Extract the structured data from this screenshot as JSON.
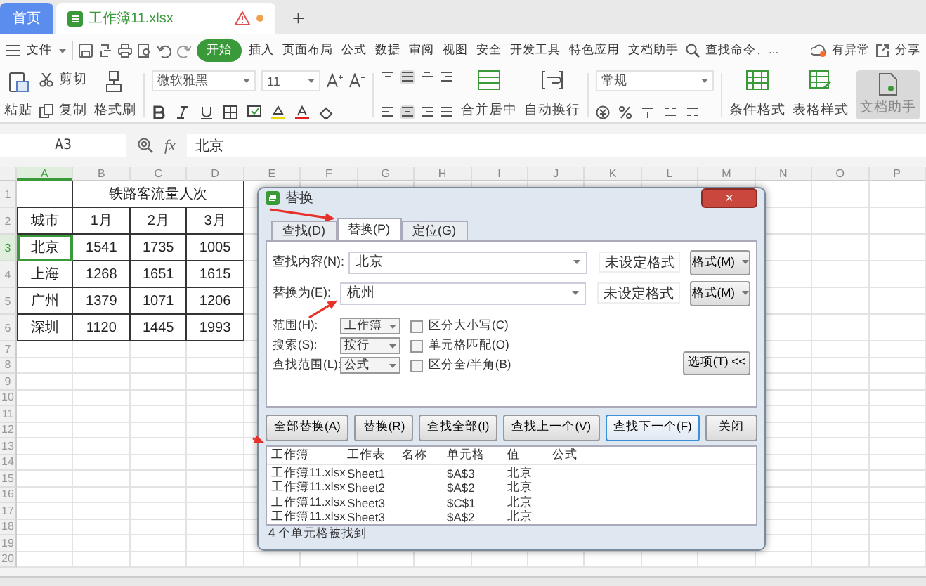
{
  "app_tabs": [
    {
      "label": "首页",
      "kind": "home",
      "selected": false
    },
    {
      "label": "工作簿11.xlsx",
      "kind": "document",
      "selected": true,
      "warning": true,
      "unsaved": true
    }
  ],
  "new_tab": "+",
  "menu": {
    "file": "文件",
    "tabs": [
      {
        "label": "开始",
        "selected": true
      },
      {
        "label": "插入",
        "selected": false
      },
      {
        "label": "页面布局",
        "selected": false
      },
      {
        "label": "公式",
        "selected": false
      },
      {
        "label": "数据",
        "selected": false
      },
      {
        "label": "审阅",
        "selected": false
      },
      {
        "label": "视图",
        "selected": false
      },
      {
        "label": "安全",
        "selected": false
      },
      {
        "label": "开发工具",
        "selected": false
      },
      {
        "label": "特色应用",
        "selected": false
      },
      {
        "label": "文档助手",
        "selected": false
      }
    ],
    "search": "查找命令、...",
    "alert": "有异常",
    "share": "分享"
  },
  "ribbon": {
    "paste": "粘贴",
    "cut": "剪切",
    "copy": "复制",
    "format_painter": "格式刷",
    "font": "微软雅黑",
    "font_size": "11",
    "merge": "合并居中",
    "wrap": "自动换行",
    "number_format": "常规",
    "conditional_format": "条件格式",
    "table_style": "表格样式",
    "assistant": "文档助手"
  },
  "formula_bar": {
    "cell": "A3",
    "fx": "fx",
    "value": "北京"
  },
  "sheet": {
    "columns": [
      {
        "label": "A",
        "selected": true
      },
      {
        "label": "B",
        "selected": false
      },
      {
        "label": "C",
        "selected": false
      },
      {
        "label": "D",
        "selected": false
      },
      {
        "label": "E",
        "selected": false
      },
      {
        "label": "F",
        "selected": false
      },
      {
        "label": "G",
        "selected": false
      },
      {
        "label": "H",
        "selected": false
      },
      {
        "label": "I",
        "selected": false
      },
      {
        "label": "J",
        "selected": false
      },
      {
        "label": "K",
        "selected": false
      },
      {
        "label": "L",
        "selected": false
      },
      {
        "label": "M",
        "selected": false
      },
      {
        "label": "N",
        "selected": false
      },
      {
        "label": "O",
        "selected": false
      },
      {
        "label": "P",
        "selected": false
      }
    ],
    "rows": [
      {
        "number": "1",
        "selected": false,
        "cells": [
          "",
          "铁路客流量人次"
        ],
        "merged_title": true
      },
      {
        "number": "2",
        "selected": false,
        "cells": [
          "城市",
          "1月",
          "2月",
          "3月"
        ]
      },
      {
        "number": "3",
        "selected": true,
        "cells": [
          "北京",
          "1541",
          "1735",
          "1005"
        ]
      },
      {
        "number": "4",
        "selected": false,
        "cells": [
          "上海",
          "1268",
          "1651",
          "1615"
        ]
      },
      {
        "number": "5",
        "selected": false,
        "cells": [
          "广州",
          "1379",
          "1071",
          "1206"
        ]
      },
      {
        "number": "6",
        "selected": false,
        "cells": [
          "深圳",
          "1120",
          "1445",
          "1993"
        ]
      },
      {
        "number": "7",
        "selected": false,
        "cells": []
      },
      {
        "number": "8",
        "selected": false,
        "cells": []
      },
      {
        "number": "9",
        "selected": false,
        "cells": []
      },
      {
        "number": "10",
        "selected": false,
        "cells": []
      },
      {
        "number": "11",
        "selected": false,
        "cells": []
      },
      {
        "number": "12",
        "selected": false,
        "cells": []
      },
      {
        "number": "13",
        "selected": false,
        "cells": []
      },
      {
        "number": "14",
        "selected": false,
        "cells": []
      },
      {
        "number": "15",
        "selected": false,
        "cells": []
      },
      {
        "number": "16",
        "selected": false,
        "cells": []
      },
      {
        "number": "17",
        "selected": false,
        "cells": []
      },
      {
        "number": "18",
        "selected": false,
        "cells": []
      },
      {
        "number": "19",
        "selected": false,
        "cells": []
      },
      {
        "number": "20",
        "selected": false,
        "cells": []
      }
    ]
  },
  "dialog": {
    "title": "替换",
    "close": "×",
    "tabs": [
      {
        "label": "查找(D)",
        "selected": false
      },
      {
        "label": "替换(P)",
        "selected": true
      },
      {
        "label": "定位(G)",
        "selected": false
      }
    ],
    "fields": [
      {
        "label": "查找内容(N):",
        "value": "北京",
        "format_status": "未设定格式",
        "format_button": "格式(M)"
      },
      {
        "label": "替换为(E):",
        "value": "杭州",
        "format_status": "未设定格式",
        "format_button": "格式(M)"
      }
    ],
    "options": [
      {
        "label": "范围(H):",
        "value": "工作簿",
        "checkbox": "区分大小写(C)",
        "checked": false
      },
      {
        "label": "搜索(S):",
        "value": "按行",
        "checkbox": "单元格匹配(O)",
        "checked": false
      },
      {
        "label": "查找范围(L):",
        "value": "公式",
        "checkbox": "区分全/半角(B)",
        "checked": false
      }
    ],
    "options_button": "选项(T) <<",
    "buttons": [
      {
        "label": "全部替换(A)",
        "default": false
      },
      {
        "label": "替换(R)",
        "default": false
      },
      {
        "label": "查找全部(I)",
        "default": false
      },
      {
        "label": "查找上一个(V)",
        "default": false
      },
      {
        "label": "查找下一个(F)",
        "default": true
      }
    ],
    "close_button": "关闭",
    "results": {
      "columns": [
        "工作簿",
        "工作表",
        "名称",
        "单元格",
        "值",
        "公式"
      ],
      "rows": [
        [
          "工作簿11.xlsx",
          "Sheet1",
          "",
          "$A$3",
          "北京",
          ""
        ],
        [
          "工作簿11.xlsx",
          "Sheet2",
          "",
          "$A$2",
          "北京",
          ""
        ],
        [
          "工作簿11.xlsx",
          "Sheet3",
          "",
          "$C$1",
          "北京",
          ""
        ],
        [
          "工作簿11.xlsx",
          "Sheet3",
          "",
          "$A$2",
          "北京",
          ""
        ]
      ]
    },
    "status": "4 个单元格被找到"
  },
  "annotation_arrows": [
    {
      "kind": "arrow"
    },
    {
      "kind": "arrow"
    },
    {
      "kind": "arrow"
    }
  ]
}
